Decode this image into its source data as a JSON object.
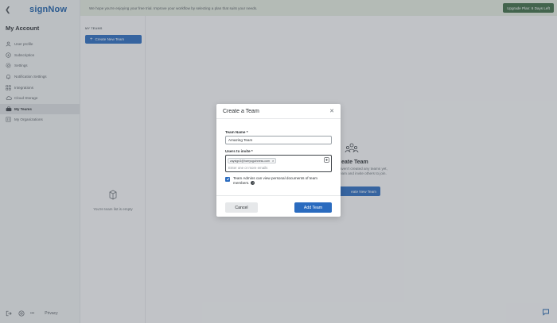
{
  "app": {
    "logo": "signNow",
    "back_icon": "back-arrow-icon"
  },
  "sidebar": {
    "title": "My Account",
    "items": [
      {
        "label": "User profile",
        "icon": "user-icon",
        "active": false
      },
      {
        "label": "Subscription",
        "icon": "card-icon",
        "active": false
      },
      {
        "label": "Settings",
        "icon": "gear-icon",
        "active": false
      },
      {
        "label": "Notification Settings",
        "icon": "bell-icon",
        "active": false
      },
      {
        "label": "Integrations",
        "icon": "grid-icon",
        "active": false
      },
      {
        "label": "Cloud Storage",
        "icon": "cloud-icon",
        "active": false
      },
      {
        "label": "My Teams",
        "icon": "team-icon",
        "active": true
      },
      {
        "label": "My Organizations",
        "icon": "org-icon",
        "active": false
      }
    ],
    "bottom": {
      "privacy": "Privacy",
      "more": "•••"
    }
  },
  "banner": {
    "text": "We hope you're enjoying your free trial. Improve your workflow by selecting a plan that suits your needs.",
    "upgrade_label": "Upgrade Plan: 6 Days Left"
  },
  "main": {
    "section_label": "MY TEAMS",
    "create_label": "Create New Team",
    "empty_left": "You're team list is empty",
    "empty_right_title": "eate Team",
    "empty_right_desc_1": "aven't created any teams yet,",
    "empty_right_desc_2": "eam and invite others to join.",
    "create_right_label": "eate New Team"
  },
  "modal": {
    "title": "Create a Team",
    "team_name_label": "Team Name *",
    "team_name_value": "Amazing Team",
    "users_label": "Users to invite *",
    "chip_email": "zaysign3@harrysguinness.com",
    "users_placeholder": "Enter one or more emails",
    "checkbox_text": "Team Admins can view personal documents of team members.",
    "checkbox_checked": true,
    "cancel_label": "Cancel",
    "add_label": "Add Team"
  },
  "colors": {
    "primary": "#2a6bbf",
    "upgrade": "#3d6b45",
    "banner_bg": "#e3eadf"
  }
}
